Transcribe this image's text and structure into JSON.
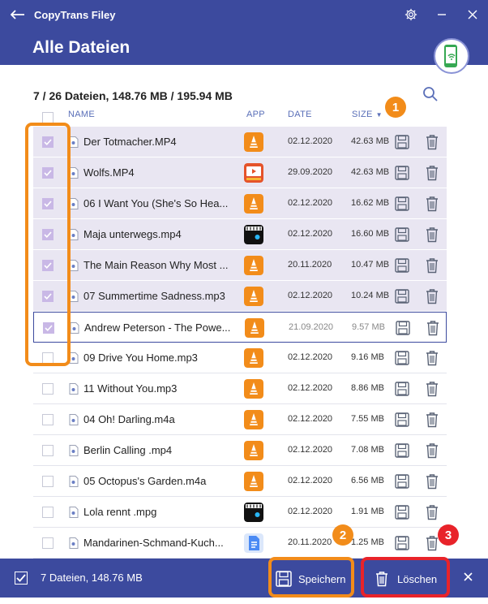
{
  "window": {
    "app_name": "CopyTrans Filey",
    "page_title": "Alle Dateien"
  },
  "summary": "7 / 26 Dateien, 148.76 MB / 195.94 MB",
  "columns": {
    "name": "NAME",
    "app": "APP",
    "date": "DATE",
    "size": "SIZE"
  },
  "files": [
    {
      "name": "Der Totmacher.MP4",
      "app": "vlc",
      "date": "02.12.2020",
      "size": "42.63 MB",
      "checked": true
    },
    {
      "name": "Wolfs.MP4",
      "app": "player",
      "date": "29.09.2020",
      "size": "42.63 MB",
      "checked": true
    },
    {
      "name": "06 I Want You (She's So Hea...",
      "app": "vlc",
      "date": "02.12.2020",
      "size": "16.62 MB",
      "checked": true
    },
    {
      "name": "Maja unterwegs.mp4",
      "app": "mp",
      "date": "02.12.2020",
      "size": "16.60 MB",
      "checked": true
    },
    {
      "name": "The Main Reason Why Most ...",
      "app": "vlc",
      "date": "20.11.2020",
      "size": "10.47 MB",
      "checked": true
    },
    {
      "name": "07 Summertime Sadness.mp3",
      "app": "vlc",
      "date": "02.12.2020",
      "size": "10.24 MB",
      "checked": true
    },
    {
      "name": "Andrew Peterson - The Powe...",
      "app": "vlc",
      "date": "21.09.2020",
      "size": "9.57 MB",
      "checked": true,
      "focused": true
    },
    {
      "name": "09 Drive You Home.mp3",
      "app": "vlc",
      "date": "02.12.2020",
      "size": "9.16 MB",
      "checked": false
    },
    {
      "name": "11 Without You.mp3",
      "app": "vlc",
      "date": "02.12.2020",
      "size": "8.86 MB",
      "checked": false
    },
    {
      "name": "04 Oh! Darling.m4a",
      "app": "vlc",
      "date": "02.12.2020",
      "size": "7.55 MB",
      "checked": false
    },
    {
      "name": "Berlin Calling .mp4",
      "app": "vlc",
      "date": "02.12.2020",
      "size": "7.08 MB",
      "checked": false
    },
    {
      "name": "05 Octopus's Garden.m4a",
      "app": "vlc",
      "date": "02.12.2020",
      "size": "6.56 MB",
      "checked": false
    },
    {
      "name": "Lola rennt .mpg",
      "app": "mp",
      "date": "02.12.2020",
      "size": "1.91 MB",
      "checked": false
    },
    {
      "name": "Mandarinen-Schmand-Kuch...",
      "app": "docs",
      "date": "20.11.2020",
      "size": "1.25 MB",
      "checked": false
    }
  ],
  "bottom": {
    "selection": "7 Dateien, 148.76 MB",
    "save_label": "Speichern",
    "delete_label": "Löschen"
  },
  "annotations": {
    "one": "1",
    "two": "2",
    "three": "3"
  },
  "colors": {
    "brand": "#3c4a9e",
    "accent": "#5a6fb8",
    "selected_row": "#e9e6f2",
    "vlc": "#f28c1a",
    "highlight_orange": "#f28c1a",
    "highlight_red": "#e8232a"
  },
  "icons": {
    "back": "back-arrow-icon",
    "settings": "gear-icon",
    "minimize": "minimize-icon",
    "close": "close-icon",
    "search": "search-icon",
    "save": "floppy-disk-icon",
    "delete": "trash-icon",
    "device": "phone-wifi-icon"
  }
}
